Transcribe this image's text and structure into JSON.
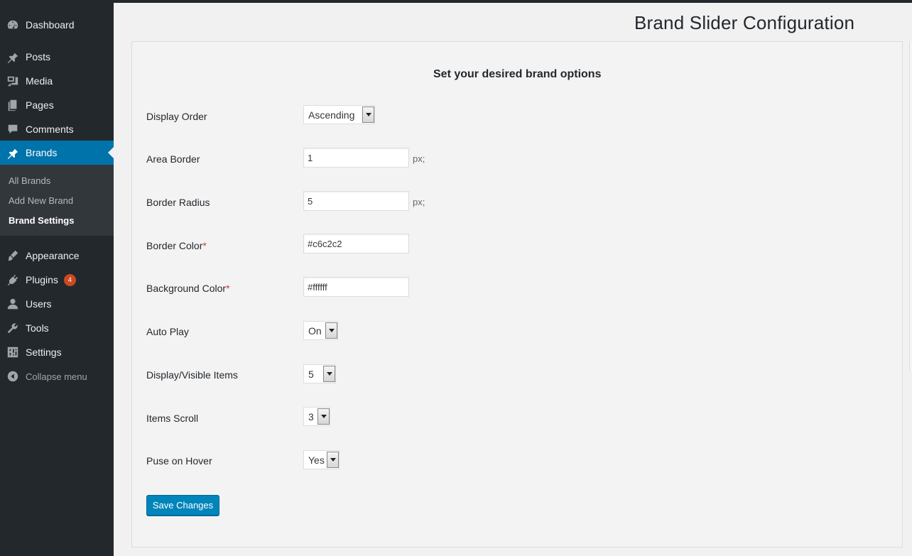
{
  "sidebar": {
    "items": [
      {
        "label": "Dashboard",
        "icon": "dashboard-icon"
      },
      {
        "label": "Posts",
        "icon": "pin-icon"
      },
      {
        "label": "Media",
        "icon": "media-icon"
      },
      {
        "label": "Pages",
        "icon": "pages-icon"
      },
      {
        "label": "Comments",
        "icon": "comment-icon"
      },
      {
        "label": "Brands",
        "icon": "pin-icon"
      },
      {
        "label": "Appearance",
        "icon": "brush-icon"
      },
      {
        "label": "Plugins",
        "icon": "plug-icon",
        "badge": "4"
      },
      {
        "label": "Users",
        "icon": "user-icon"
      },
      {
        "label": "Tools",
        "icon": "wrench-icon"
      },
      {
        "label": "Settings",
        "icon": "sliders-icon"
      },
      {
        "label": "Collapse menu",
        "icon": "collapse-arrow-icon"
      }
    ],
    "submenu": [
      {
        "label": "All Brands"
      },
      {
        "label": "Add New Brand"
      },
      {
        "label": "Brand Settings"
      }
    ]
  },
  "page": {
    "title": "Brand Slider Configuration",
    "heading": "Set your desired brand options"
  },
  "form": {
    "display_order": {
      "label": "Display Order",
      "value": "Ascending"
    },
    "area_border": {
      "label": "Area Border",
      "value": "1",
      "unit": "px;"
    },
    "border_radius": {
      "label": "Border Radius",
      "value": "5",
      "unit": "px;"
    },
    "border_color": {
      "label": "Border Color",
      "required": "*",
      "value": "#c6c2c2"
    },
    "background_color": {
      "label": "Background Color",
      "required": "*",
      "value": "#ffffff"
    },
    "auto_play": {
      "label": "Auto Play",
      "value": "On"
    },
    "visible_items": {
      "label": "Display/Visible Items",
      "value": "5"
    },
    "items_scroll": {
      "label": "Items Scroll",
      "value": "3"
    },
    "pause_on_hover": {
      "label": "Puse on Hover",
      "value": "Yes"
    },
    "save_label": "Save Changes"
  },
  "colors": {
    "sidebar_bg": "#23282d",
    "active": "#0073aa",
    "button": "#0085ba",
    "badge": "#ca4a1f",
    "required": "#dc3232"
  }
}
